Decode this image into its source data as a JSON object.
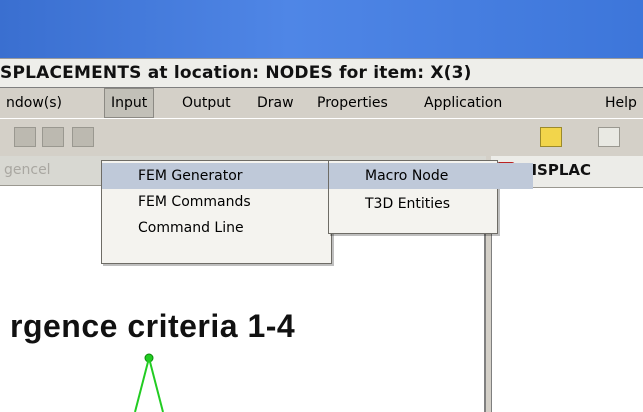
{
  "window": {
    "title": "SPLACEMENTS at location: NODES for item: X(3)"
  },
  "menubar": {
    "items": [
      {
        "label": "ndow(s)"
      },
      {
        "label": "Input"
      },
      {
        "label": "Output"
      },
      {
        "label": "Draw"
      },
      {
        "label": "Properties"
      },
      {
        "label": "Application"
      },
      {
        "label": "Help"
      }
    ]
  },
  "input_menu": {
    "items": [
      {
        "label": "FEM Generator"
      },
      {
        "label": "FEM Commands"
      },
      {
        "label": "Command Line"
      }
    ]
  },
  "fem_generator_submenu": {
    "items": [
      {
        "label": "Macro Node"
      },
      {
        "label": "T3D Entities"
      }
    ]
  },
  "left_window": {
    "title": "gencel"
  },
  "right_window": {
    "title": "DISPLAC"
  },
  "plot": {
    "title": "rgence criteria 1-4"
  },
  "colors": {
    "accent_red": "#e46f6b",
    "plot_green": "#00aa00",
    "desktop_blue": "#3d76da"
  },
  "icons": [
    "grid-icon",
    "plot-icon",
    "toolbar-icon",
    "magnify-icon"
  ]
}
